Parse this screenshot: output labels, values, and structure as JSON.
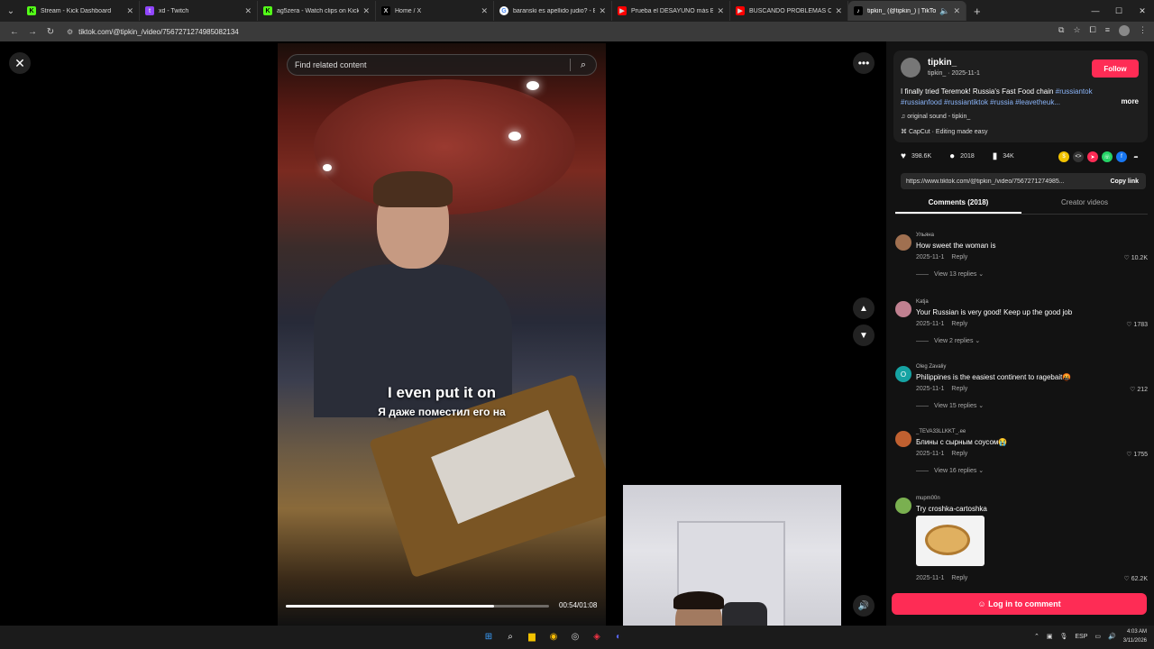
{
  "browser": {
    "tabs": [
      {
        "title": "Stream - Kick Dashboard",
        "icon": "K",
        "color": "#53fc18"
      },
      {
        "title": "xd - Twitch",
        "icon": "t",
        "color": "#9146ff"
      },
      {
        "title": "ag5zera - Watch clips on Kick",
        "icon": "K",
        "color": "#53fc18"
      },
      {
        "title": "Home / X",
        "icon": "X",
        "color": "#000000"
      },
      {
        "title": "baranski es apellido judio? - Bu",
        "icon": "G",
        "color": "#ffffff"
      },
      {
        "title": "Prueba el DESAYUNO más BAR",
        "icon": "▶",
        "color": "#ff0000"
      },
      {
        "title": "BUSCANDO PROBLEMAS CON",
        "icon": "▶",
        "color": "#ff0000"
      },
      {
        "title": "tipkin_ (@tipkin_) | TikTok",
        "icon": "♪",
        "color": "#000000"
      }
    ],
    "url": "tiktok.com/@tipkin_/video/7567271274985082134"
  },
  "video": {
    "search_placeholder": "Find related content",
    "caption_en": "I even put it on",
    "caption_ru": "Я даже поместил его на",
    "timecode": "00:54/01:08",
    "progress": 0.79
  },
  "panel": {
    "username": "tipkin_",
    "subline": "tipkin_ · 2025-11-1",
    "follow_label": "Follow",
    "desc_text": "I finally tried Teremok! Russia's Fast Food chain ",
    "desc_tags": "#russiantok #russianfood #russiantiktok #russia #leavetheuk...",
    "more_label": "more",
    "sound": "original sound - tipkin_",
    "capcut": "CapCut · Editing made easy",
    "likes": "398.6K",
    "comments_count": "2018",
    "saves": "34K",
    "link": "https://www.tiktok.com/@tipkin_/video/7567271274985...",
    "copy_label": "Copy link",
    "tab_comments": "Comments (2018)",
    "tab_creator": "Creator videos",
    "login_label": "Log in to comment"
  },
  "comments": [
    {
      "user": "Ульяна",
      "text": "How sweet the woman is",
      "date": "2025-11-1",
      "reply": "Reply",
      "likes": "10.2K",
      "replies": "View 13 replies",
      "avcolor": "#a07050"
    },
    {
      "user": "Katja",
      "text": "Your Russian is very good! Keep up the good job",
      "date": "2025-11-1",
      "reply": "Reply",
      "likes": "1783",
      "replies": "View 2 replies",
      "avcolor": "#c08090"
    },
    {
      "user": "Oleg Zavaliy",
      "text": "Philippines is the easiest continent to ragebait🤬",
      "date": "2025-11-1",
      "reply": "Reply",
      "likes": "212",
      "replies": "View 15 replies",
      "avcolor": "#16a3a3",
      "avletter": "O"
    },
    {
      "user": "_TEVA33LLKKT_.ee",
      "text": "Блины с сырным соусом😭",
      "date": "2025-11-1",
      "reply": "Reply",
      "likes": "1755",
      "replies": "View 16 replies",
      "avcolor": "#c06030"
    },
    {
      "user": "mupm00n",
      "text": "Try croshka-cartoshka",
      "date": "2025-11-1",
      "reply": "Reply",
      "likes": "62.2K",
      "avcolor": "#7ab050"
    }
  ],
  "taskbar": {
    "lang": "ESP",
    "time": "4:03 AM",
    "date": "3/11/2026"
  }
}
